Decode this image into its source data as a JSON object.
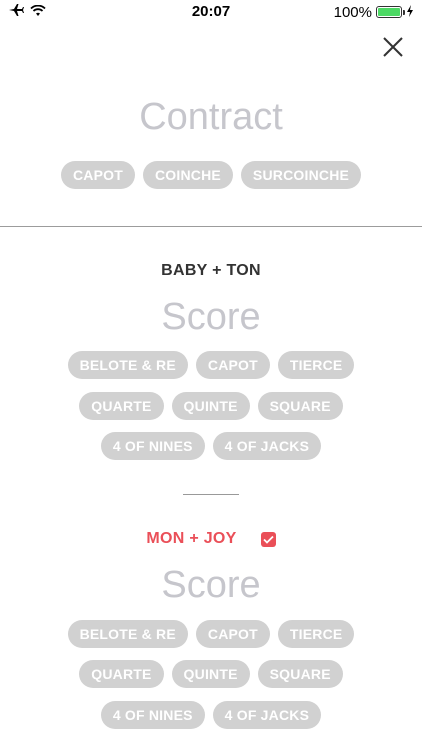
{
  "status": {
    "time": "20:07",
    "battery": "100%",
    "battery_fill": 1.0,
    "icons": [
      "airplane-icon",
      "wifi-icon",
      "battery-icon",
      "charging-icon"
    ]
  },
  "contract": {
    "title": "Contract",
    "options": [
      "CAPOT",
      "COINCHE",
      "SURCOINCHE"
    ]
  },
  "teams": [
    {
      "name": "BABY + TON",
      "score_title": "Score",
      "bonus_rows": [
        [
          "BELOTE & RE",
          "CAPOT",
          "TIERCE"
        ],
        [
          "QUARTE",
          "QUINTE",
          "SQUARE"
        ],
        [
          "4 OF NINES",
          "4 OF JACKS"
        ]
      ]
    },
    {
      "name": "MON + JOY",
      "checked": true,
      "score_title": "Score",
      "bonus_rows": [
        [
          "BELOTE & RE",
          "CAPOT",
          "TIERCE"
        ],
        [
          "QUARTE",
          "QUINTE",
          "SQUARE"
        ],
        [
          "4 OF NINES",
          "4 OF JACKS"
        ]
      ]
    }
  ],
  "colors": {
    "chip_bg": "#d1d1d1",
    "accent_red": "#ea4f58",
    "title_gray": "#c6c6cc",
    "battery_green": "#4cd964"
  }
}
